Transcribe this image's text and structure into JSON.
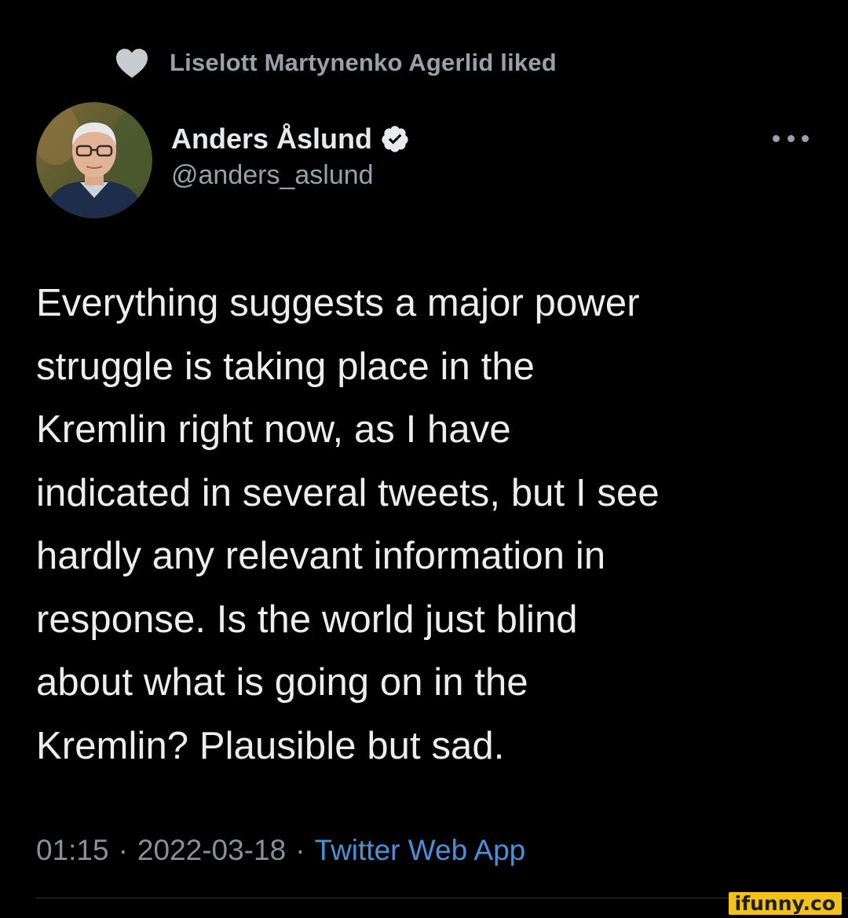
{
  "social_context": {
    "icon": "heart-icon",
    "text": "Liselott Martynenko Agerlid liked"
  },
  "author": {
    "display_name": "Anders Åslund",
    "handle": "@anders_aslund",
    "verified": true,
    "verified_icon": "verified-badge-icon"
  },
  "more_icon": "more-options-icon",
  "tweet": {
    "lines": [
      "Everything suggests a major power",
      "struggle is taking place in the",
      "Kremlin right now, as I have",
      "indicated in several tweets, but I see",
      "hardly any relevant information in",
      "response. Is the world just blind",
      "about what is going on in the",
      "Kremlin? Plausible but sad."
    ]
  },
  "meta": {
    "time": "01:15",
    "separator": "·",
    "date": "2022-03-18",
    "source": "Twitter Web App"
  },
  "watermark": "ifunny.co",
  "colors": {
    "background": "#000000",
    "text_primary": "#e7e9ea",
    "text_secondary": "#9aa0a6",
    "link": "#4a90d9",
    "verified": "#e7e9ea"
  }
}
